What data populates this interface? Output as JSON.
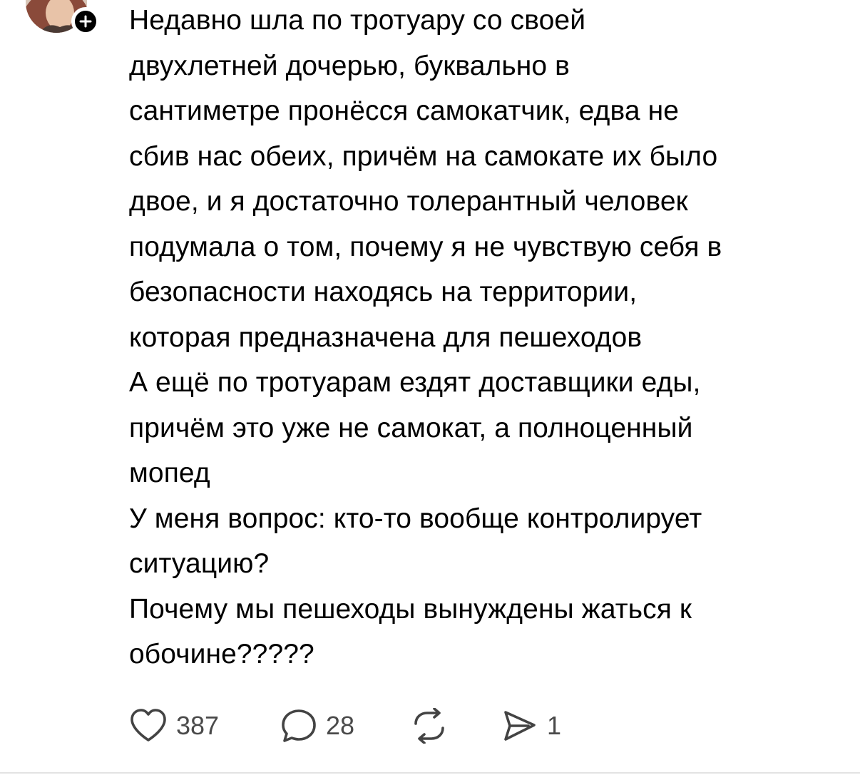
{
  "post": {
    "paragraphs": [
      "Недавно шла по тротуару со своей\nдвухлетней дочерью, буквально в\nсантиметре пронёсся самокатчик, едва не\nсбив нас обеих, причём на самокате их было\nдвое, и я достаточно толерантный человек\nподумала о том, почему я не чувствую себя в\nбезопасности находясь на территории,\nкоторая предназначена для пешеходов",
      "А ещё по тротуарам ездят доставщики еды,\nпричём это уже не самокат, а полноценный\nмопед",
      "У меня вопрос: кто-то вообще контролирует\nситуацию?",
      "Почему мы пешеходы вынуждены жаться к\nобочине?????"
    ]
  },
  "actions": {
    "like": {
      "icon": "heart-icon",
      "count": "387"
    },
    "reply": {
      "icon": "speech-bubble-icon",
      "count": "28"
    },
    "repost": {
      "icon": "repost-icon"
    },
    "share": {
      "icon": "send-icon",
      "count": "1"
    }
  },
  "colors": {
    "text": "#000000",
    "icon": "#434343",
    "count": "#4a4a4a",
    "divider": "#e3e3e3",
    "badge": "#000000"
  }
}
